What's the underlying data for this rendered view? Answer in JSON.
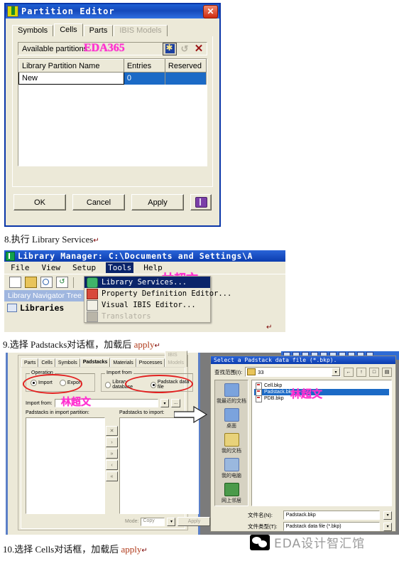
{
  "partition_editor": {
    "title": "Partition Editor",
    "icon": "partition-window-icon",
    "close_label": "✕",
    "tabs": [
      {
        "label": "Symbols",
        "state": "normal"
      },
      {
        "label": "Cells",
        "state": "active"
      },
      {
        "label": "Parts",
        "state": "normal"
      },
      {
        "label": "IBIS Models",
        "state": "disabled"
      }
    ],
    "available_label": "Available partitions:",
    "watermark": "EDA365",
    "toolbar": [
      {
        "name": "new-partition-icon",
        "glyph": "✱"
      },
      {
        "name": "undo-icon",
        "glyph": "↺"
      },
      {
        "name": "delete-icon",
        "glyph": "✕"
      }
    ],
    "table": {
      "columns": [
        "Library Partition Name",
        "Entries",
        "Reserved"
      ],
      "rows": [
        [
          "New",
          "0",
          ""
        ]
      ]
    },
    "buttons": [
      {
        "label": "OK",
        "name": "ok-button"
      },
      {
        "label": "Cancel",
        "name": "cancel-button"
      },
      {
        "label": "Apply",
        "name": "apply-button"
      },
      {
        "label": "",
        "name": "help-book-button"
      }
    ]
  },
  "step8": {
    "number": "8.",
    "cn": "执行",
    "en": "Library Services",
    "cr": "↵"
  },
  "library_manager": {
    "title": "Library Manager: C:\\Documents and Settings\\A",
    "menus": [
      {
        "label": "File",
        "state": "normal"
      },
      {
        "label": "View",
        "state": "normal"
      },
      {
        "label": "Setup",
        "state": "normal"
      },
      {
        "label": "Tools",
        "state": "selected"
      },
      {
        "label": "Help",
        "state": "normal"
      }
    ],
    "watermark": "林超文",
    "toolbar": [
      {
        "name": "new-file-icon"
      },
      {
        "name": "open-folder-icon"
      },
      {
        "name": "find-icon"
      },
      {
        "name": "refresh-icon"
      }
    ],
    "nav_tree_label": "Library Navigator Tree",
    "libraries_label": "Libraries",
    "tools_menu": [
      {
        "label": "Library Services...",
        "state": "selected",
        "icon": "library-services-icon"
      },
      {
        "label": "Property Definition Editor...",
        "state": "normal",
        "icon": "property-definition-icon"
      },
      {
        "label": "Visual IBIS Editor...",
        "state": "normal",
        "icon": "visual-ibis-icon"
      },
      {
        "label": "Translators",
        "state": "dim",
        "icon": "translators-icon"
      }
    ]
  },
  "step9": {
    "number": "9.",
    "cn1": "选择",
    "en": "Padstacks",
    "cn2": "对话框，加载后",
    "apply": "apply",
    "cr": "↵"
  },
  "padstacks_dialog": {
    "tabs": [
      {
        "label": "Parts",
        "state": "normal"
      },
      {
        "label": "Cells",
        "state": "normal"
      },
      {
        "label": "Symbols",
        "state": "normal"
      },
      {
        "label": "Padstacks",
        "state": "active"
      },
      {
        "label": "Materials",
        "state": "normal"
      },
      {
        "label": "Processes",
        "state": "normal"
      },
      {
        "label": "IBIS Models",
        "state": "disabled"
      }
    ],
    "operation_legend": "Operation",
    "operation_options": [
      {
        "label": "Import",
        "checked": true
      },
      {
        "label": "Export",
        "checked": false
      }
    ],
    "import_from_legend": "Import from",
    "import_from_options": [
      {
        "label": "Library database",
        "checked": false
      },
      {
        "label": "Padstack data file",
        "checked": true
      }
    ],
    "import_from_label": "Import from:",
    "import_from_value": "",
    "browse_label": "...",
    "left_list_label": "Padstacks in import partition:",
    "right_list_label": "Padstacks to import:",
    "transfer_buttons": [
      "✕",
      "›",
      "»",
      "‹",
      "«"
    ],
    "mode_label": "Mode:",
    "mode_value": "Copy",
    "apply_label": "Apply",
    "watermark": "林超文"
  },
  "file_dialog": {
    "title": "Select a Padstack data file (*.bkp).",
    "look_in_label": "查找范围(I):",
    "look_in_value": "33",
    "nav_icons": [
      {
        "name": "back-icon",
        "glyph": "←"
      },
      {
        "name": "up-one-level-icon",
        "glyph": "↑"
      },
      {
        "name": "new-folder-icon",
        "glyph": "□"
      },
      {
        "name": "views-icon",
        "glyph": "▤"
      }
    ],
    "places": [
      {
        "label": "我最近的文档",
        "icon": "recent-documents-icon"
      },
      {
        "label": "桌面",
        "icon": "desktop-icon"
      },
      {
        "label": "我的文档",
        "icon": "my-documents-icon"
      },
      {
        "label": "我的电脑",
        "icon": "my-computer-icon"
      },
      {
        "label": "网上邻居",
        "icon": "network-places-icon"
      }
    ],
    "files": [
      {
        "name": "Cell.bkp",
        "selected": false
      },
      {
        "name": "Padstack.bkp",
        "selected": true
      },
      {
        "name": "PDB.bkp",
        "selected": false
      }
    ],
    "filename_label": "文件名(N):",
    "filename_value": "Padstack.bkp",
    "filetype_label": "文件类型(T):",
    "filetype_value": "Padstack data file (*.bkp)",
    "watermark": "林超文"
  },
  "step10": {
    "number": "10.",
    "cn1": "选择",
    "en": "Cells",
    "cn2": "对话框，加载后",
    "apply": "apply",
    "cr": "↵"
  },
  "watermark_footer": {
    "text": "EDA设计智汇馆",
    "icon": "wechat-icon"
  },
  "colors": {
    "title_blue": "#0b3cae",
    "face": "#ece9d8",
    "magenta": "#ff2fd0",
    "select_blue": "#1b6ac6",
    "highlight_red": "#e22020"
  }
}
